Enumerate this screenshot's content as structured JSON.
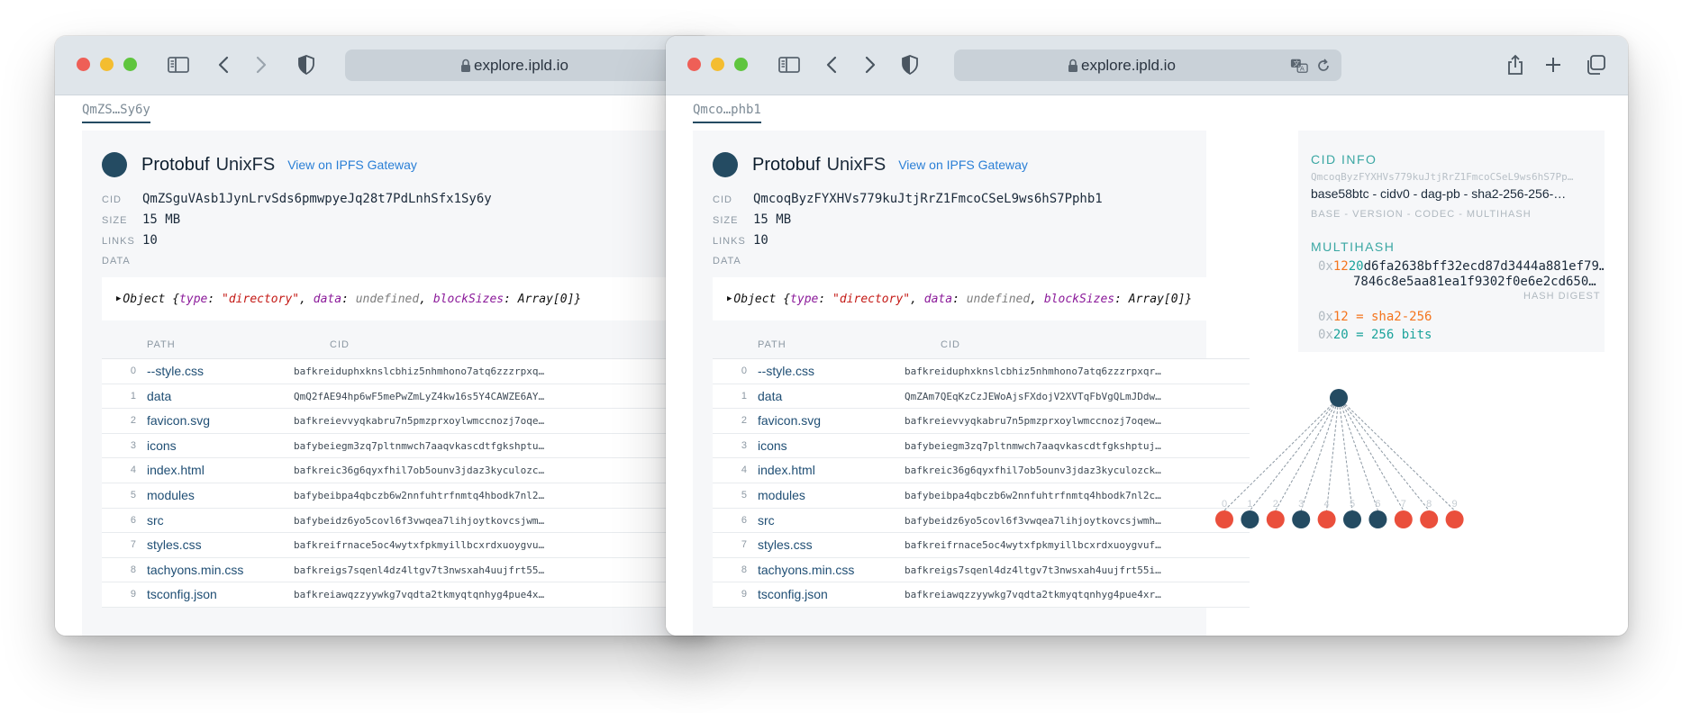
{
  "left_window": {
    "url": "explore.ipld.io",
    "breadcrumb": "QmZS…Sy6y",
    "node": {
      "codec": "Protobuf",
      "type": "UnixFS",
      "gateway_link": "View on IPFS Gateway",
      "cid_label": "CID",
      "cid": "QmZSguVAsb1JynLrvSds6pmwpyeJq28t7PdLnhSfx1Sy6y",
      "size_label": "SIZE",
      "size": "15 MB",
      "links_label": "LINKS",
      "links": "10",
      "data_label": "DATA"
    },
    "object_summary": {
      "prefix": "Object {",
      "type_key": "type",
      "type_value": "\"directory\"",
      "data_key": "data",
      "data_value": "undefined",
      "blocksizes_key": "blockSizes",
      "blocksizes_value": "Array[0]",
      "suffix": "}"
    },
    "table": {
      "headers": [
        "PATH",
        "CID"
      ],
      "rows": [
        {
          "index": "0",
          "path": "--style.css",
          "cid": "bafkreiduphxknslcbhiz5nhmhono7atq6zzzrpxqr336dc…"
        },
        {
          "index": "1",
          "path": "data",
          "cid": "QmQ2fAE94hp6wF5mePwZmLyZ4kw16s5Y4CAWZE6AYVaesQ"
        },
        {
          "index": "2",
          "path": "favicon.svg",
          "cid": "bafkreievvyqkabru7n5pmzprxoylwmccnozj7oqewtj7zz…"
        },
        {
          "index": "3",
          "path": "icons",
          "cid": "bafybeiegm3zq7pltnmwch7aaqvkascdtfgkshptujob3tz…"
        },
        {
          "index": "4",
          "path": "index.html",
          "cid": "bafkreic36g6qyxfhil7ob5ounv3jdaz3kyculozckmnhq3…"
        },
        {
          "index": "5",
          "path": "modules",
          "cid": "bafybeibpa4qbczb6w2nnfuhtrfnmtq4hbodk7nl2covmun…"
        },
        {
          "index": "6",
          "path": "src",
          "cid": "bafybeidz6yo5covl6f3vwqea7lihjoytkovcsjwmhmbas5…"
        },
        {
          "index": "7",
          "path": "styles.css",
          "cid": "bafkreifrnace5oc4wytxfpkmyillbcxrdxuoygvufciyxu…"
        },
        {
          "index": "8",
          "path": "tachyons.min.css",
          "cid": "bafkreigs7sqenl4dz4ltgv7t3nwsxah4uujfrt55i23x4u…"
        },
        {
          "index": "9",
          "path": "tsconfig.json",
          "cid": "bafkreiawqzzyywkg7vqdta2tkmyqtqnhyg4pue4xrswsxj…"
        }
      ]
    }
  },
  "right_window": {
    "url": "explore.ipld.io",
    "breadcrumb": "Qmco…phb1",
    "node": {
      "codec": "Protobuf",
      "type": "UnixFS",
      "gateway_link": "View on IPFS Gateway",
      "cid_label": "CID",
      "cid": "QmcoqByzFYXHVs779kuJtjRrZ1FmcoCSeL9ws6hS7Pphb1",
      "size_label": "SIZE",
      "size": "15 MB",
      "links_label": "LINKS",
      "links": "10",
      "data_label": "DATA"
    },
    "object_summary": {
      "prefix": "Object {",
      "type_key": "type",
      "type_value": "\"directory\"",
      "data_key": "data",
      "data_value": "undefined",
      "blocksizes_key": "blockSizes",
      "blocksizes_value": "Array[0]",
      "suffix": "}"
    },
    "table": {
      "headers": [
        "PATH",
        "CID"
      ],
      "rows": [
        {
          "index": "0",
          "path": "--style.css",
          "cid": "bafkreiduphxknslcbhiz5nhmhono7atq6zzzrpxqr336dc…"
        },
        {
          "index": "1",
          "path": "data",
          "cid": "QmZAm7QEqKzCzJEWoAjsFXdojV2XVTqFbVgQLmJDdwwYGQ"
        },
        {
          "index": "2",
          "path": "favicon.svg",
          "cid": "bafkreievvyqkabru7n5pmzprxoylwmccnozj7oqewtj7zz…"
        },
        {
          "index": "3",
          "path": "icons",
          "cid": "bafybeiegm3zq7pltnmwch7aaqvkascdtfgkshptujob3tz…"
        },
        {
          "index": "4",
          "path": "index.html",
          "cid": "bafkreic36g6qyxfhil7ob5ounv3jdaz3kyculozckmnhq3…"
        },
        {
          "index": "5",
          "path": "modules",
          "cid": "bafybeibpa4qbczb6w2nnfuhtrfnmtq4hbodk7nl2covmun…"
        },
        {
          "index": "6",
          "path": "src",
          "cid": "bafybeidz6yo5covl6f3vwqea7lihjoytkovcsjwmhmbas5…"
        },
        {
          "index": "7",
          "path": "styles.css",
          "cid": "bafkreifrnace5oc4wytxfpkmyillbcxrdxuoygvufciyxu…"
        },
        {
          "index": "8",
          "path": "tachyons.min.css",
          "cid": "bafkreigs7sqenl4dz4ltgv7t3nwsxah4uujfrt55i23x4u…"
        },
        {
          "index": "9",
          "path": "tsconfig.json",
          "cid": "bafkreiawqzzyywkg7vqdta2tkmyqtqnhyg4pue4xrswsxj…"
        }
      ]
    },
    "cid_info": {
      "heading": "CID INFO",
      "cid_small": "QmcoqByzFYXHVs779kuJtjRrZ1FmcoCSeL9ws6hS7Pp…",
      "description": "base58btc - cidv0 - dag-pb - sha2-256-256-…",
      "caption": "BASE - VERSION - CODEC - MULTIHASH"
    },
    "multihash": {
      "heading": "MULTIHASH",
      "prefix": "0x",
      "code": "12",
      "length": "20",
      "digest_line1": "d6fa2638bff32ecd87d3444a881ef79…",
      "digest_line2": "7846c8e5aa81ea1f9302f0e6e2cd650…",
      "digest_caption": "HASH DIGEST",
      "code_line_prefix": "0x",
      "code_line_code": "12",
      "code_line_text": " = sha2-256",
      "length_line_prefix": "0x",
      "length_line_code": "20",
      "length_line_text": " = 256 bits"
    },
    "dag": {
      "leaf_labels": [
        "0",
        "1",
        "2",
        "3",
        "4",
        "5",
        "6",
        "7",
        "8",
        "9"
      ],
      "leaf_kinds": [
        "file",
        "directory",
        "file",
        "directory",
        "file",
        "directory",
        "directory",
        "file",
        "file",
        "file"
      ]
    }
  },
  "colors": {
    "node_dark": "#244b62",
    "node_file": "#ea4f3c",
    "accent_teal": "#3aa7a3",
    "link_blue": "#2a7fd6",
    "hex_orange": "#f4751e",
    "hex_teal": "#1ba39b"
  },
  "icons": [
    "sidebar-icon",
    "back-icon",
    "forward-icon",
    "shield-icon",
    "lock-icon",
    "translate-icon",
    "reload-icon",
    "share-icon",
    "plus-icon",
    "tabs-icon"
  ]
}
